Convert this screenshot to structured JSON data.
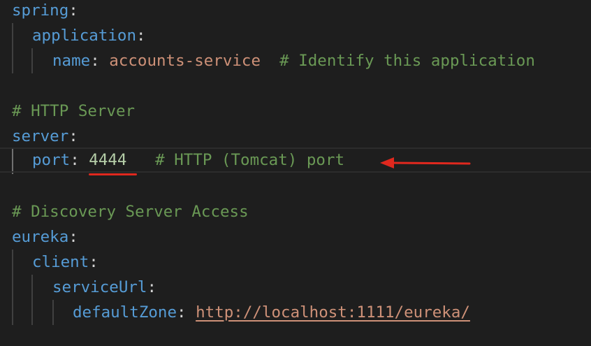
{
  "lines": [
    {
      "key": "spring",
      "colon": ":"
    },
    {
      "key": "application",
      "colon": ":"
    },
    {
      "key": "name",
      "colon": ": ",
      "value": "accounts-service",
      "comment": "  # Identify this application"
    },
    {
      "comment": "# HTTP Server"
    },
    {
      "key": "server",
      "colon": ":"
    },
    {
      "key": "port",
      "colon": ": ",
      "value": "4444",
      "comment": "   # HTTP (Tomcat) port"
    },
    {
      "comment": "# Discovery Server Access"
    },
    {
      "key": "eureka",
      "colon": ":"
    },
    {
      "key": "client",
      "colon": ":"
    },
    {
      "key": "serviceUrl",
      "colon": ":"
    },
    {
      "key": "defaultZone",
      "colon": ": ",
      "value": "http://localhost:1111/eureka/"
    }
  ],
  "annotation": {
    "underline_color": "#e0281e",
    "arrow_color": "#e0281e",
    "arrow_icon": "left-arrow-icon"
  },
  "colors": {
    "background": "#1e1e1e",
    "key": "#569cd6",
    "string": "#ce9178",
    "number": "#b5cea8",
    "comment": "#6a9955"
  }
}
